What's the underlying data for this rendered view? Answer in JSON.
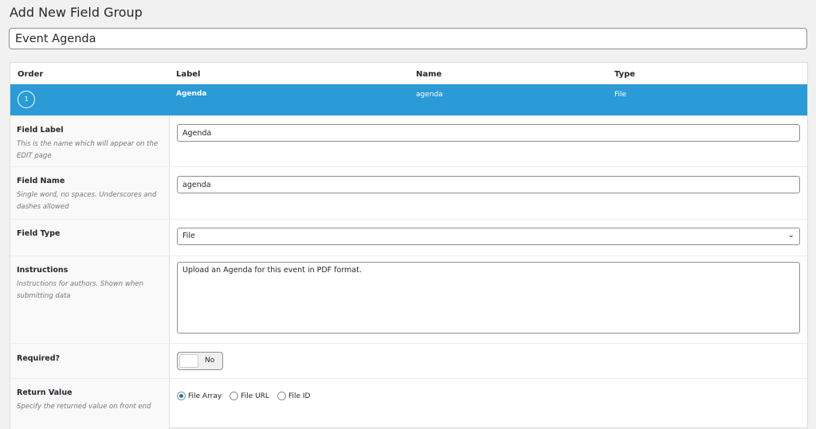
{
  "page_title": "Add New Field Group",
  "group_title": "Event Agenda",
  "columns": [
    "Order",
    "Label",
    "Name",
    "Type"
  ],
  "field": {
    "order": "1",
    "label": "Agenda",
    "name": "agenda",
    "type": "File"
  },
  "accent": "#2a9bd7",
  "settings": {
    "label": {
      "title": "Field Label",
      "desc": "This is the name which will appear on the EDIT page",
      "value": "Agenda"
    },
    "name": {
      "title": "Field Name",
      "desc": "Single word, no spaces. Underscores and dashes allowed",
      "value": "agenda"
    },
    "type": {
      "title": "Field Type",
      "value": "File",
      "icon": "chevron-down-icon"
    },
    "instructions": {
      "title": "Instructions",
      "desc": "Instructions for authors. Shown when submitting data",
      "value": "Upload an Agenda for this event in PDF format."
    },
    "required": {
      "title": "Required?",
      "value": "No"
    },
    "return": {
      "title": "Return Value",
      "desc": "Specify the returned value on front end",
      "options": [
        "File Array",
        "File URL",
        "File ID"
      ],
      "selected": "File Array"
    }
  }
}
